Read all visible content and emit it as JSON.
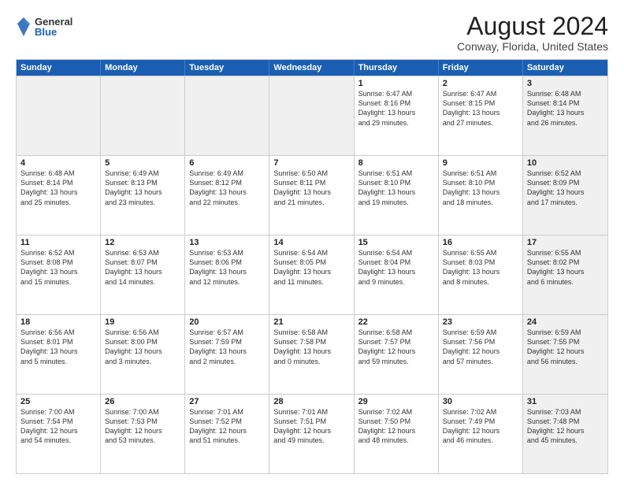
{
  "header": {
    "logo": {
      "general": "General",
      "blue": "Blue"
    },
    "title": "August 2024",
    "subtitle": "Conway, Florida, United States"
  },
  "weekdays": [
    "Sunday",
    "Monday",
    "Tuesday",
    "Wednesday",
    "Thursday",
    "Friday",
    "Saturday"
  ],
  "rows": [
    [
      {
        "day": "",
        "sunrise": "",
        "sunset": "",
        "daylight": "",
        "shaded": true
      },
      {
        "day": "",
        "sunrise": "",
        "sunset": "",
        "daylight": "",
        "shaded": true
      },
      {
        "day": "",
        "sunrise": "",
        "sunset": "",
        "daylight": "",
        "shaded": true
      },
      {
        "day": "",
        "sunrise": "",
        "sunset": "",
        "daylight": "",
        "shaded": true
      },
      {
        "day": "1",
        "sunrise": "Sunrise: 6:47 AM",
        "sunset": "Sunset: 8:16 PM",
        "daylight": "Daylight: 13 hours",
        "daylight2": "and 29 minutes.",
        "shaded": false
      },
      {
        "day": "2",
        "sunrise": "Sunrise: 6:47 AM",
        "sunset": "Sunset: 8:15 PM",
        "daylight": "Daylight: 13 hours",
        "daylight2": "and 27 minutes.",
        "shaded": false
      },
      {
        "day": "3",
        "sunrise": "Sunrise: 6:48 AM",
        "sunset": "Sunset: 8:14 PM",
        "daylight": "Daylight: 13 hours",
        "daylight2": "and 26 minutes.",
        "shaded": true
      }
    ],
    [
      {
        "day": "4",
        "sunrise": "Sunrise: 6:48 AM",
        "sunset": "Sunset: 8:14 PM",
        "daylight": "Daylight: 13 hours",
        "daylight2": "and 25 minutes.",
        "shaded": false
      },
      {
        "day": "5",
        "sunrise": "Sunrise: 6:49 AM",
        "sunset": "Sunset: 8:13 PM",
        "daylight": "Daylight: 13 hours",
        "daylight2": "and 23 minutes.",
        "shaded": false
      },
      {
        "day": "6",
        "sunrise": "Sunrise: 6:49 AM",
        "sunset": "Sunset: 8:12 PM",
        "daylight": "Daylight: 13 hours",
        "daylight2": "and 22 minutes.",
        "shaded": false
      },
      {
        "day": "7",
        "sunrise": "Sunrise: 6:50 AM",
        "sunset": "Sunset: 8:11 PM",
        "daylight": "Daylight: 13 hours",
        "daylight2": "and 21 minutes.",
        "shaded": false
      },
      {
        "day": "8",
        "sunrise": "Sunrise: 6:51 AM",
        "sunset": "Sunset: 8:10 PM",
        "daylight": "Daylight: 13 hours",
        "daylight2": "and 19 minutes.",
        "shaded": false
      },
      {
        "day": "9",
        "sunrise": "Sunrise: 6:51 AM",
        "sunset": "Sunset: 8:10 PM",
        "daylight": "Daylight: 13 hours",
        "daylight2": "and 18 minutes.",
        "shaded": false
      },
      {
        "day": "10",
        "sunrise": "Sunrise: 6:52 AM",
        "sunset": "Sunset: 8:09 PM",
        "daylight": "Daylight: 13 hours",
        "daylight2": "and 17 minutes.",
        "shaded": true
      }
    ],
    [
      {
        "day": "11",
        "sunrise": "Sunrise: 6:52 AM",
        "sunset": "Sunset: 8:08 PM",
        "daylight": "Daylight: 13 hours",
        "daylight2": "and 15 minutes.",
        "shaded": false
      },
      {
        "day": "12",
        "sunrise": "Sunrise: 6:53 AM",
        "sunset": "Sunset: 8:07 PM",
        "daylight": "Daylight: 13 hours",
        "daylight2": "and 14 minutes.",
        "shaded": false
      },
      {
        "day": "13",
        "sunrise": "Sunrise: 6:53 AM",
        "sunset": "Sunset: 8:06 PM",
        "daylight": "Daylight: 13 hours",
        "daylight2": "and 12 minutes.",
        "shaded": false
      },
      {
        "day": "14",
        "sunrise": "Sunrise: 6:54 AM",
        "sunset": "Sunset: 8:05 PM",
        "daylight": "Daylight: 13 hours",
        "daylight2": "and 11 minutes.",
        "shaded": false
      },
      {
        "day": "15",
        "sunrise": "Sunrise: 6:54 AM",
        "sunset": "Sunset: 8:04 PM",
        "daylight": "Daylight: 13 hours",
        "daylight2": "and 9 minutes.",
        "shaded": false
      },
      {
        "day": "16",
        "sunrise": "Sunrise: 6:55 AM",
        "sunset": "Sunset: 8:03 PM",
        "daylight": "Daylight: 13 hours",
        "daylight2": "and 8 minutes.",
        "shaded": false
      },
      {
        "day": "17",
        "sunrise": "Sunrise: 6:55 AM",
        "sunset": "Sunset: 8:02 PM",
        "daylight": "Daylight: 13 hours",
        "daylight2": "and 6 minutes.",
        "shaded": true
      }
    ],
    [
      {
        "day": "18",
        "sunrise": "Sunrise: 6:56 AM",
        "sunset": "Sunset: 8:01 PM",
        "daylight": "Daylight: 13 hours",
        "daylight2": "and 5 minutes.",
        "shaded": false
      },
      {
        "day": "19",
        "sunrise": "Sunrise: 6:56 AM",
        "sunset": "Sunset: 8:00 PM",
        "daylight": "Daylight: 13 hours",
        "daylight2": "and 3 minutes.",
        "shaded": false
      },
      {
        "day": "20",
        "sunrise": "Sunrise: 6:57 AM",
        "sunset": "Sunset: 7:59 PM",
        "daylight": "Daylight: 13 hours",
        "daylight2": "and 2 minutes.",
        "shaded": false
      },
      {
        "day": "21",
        "sunrise": "Sunrise: 6:58 AM",
        "sunset": "Sunset: 7:58 PM",
        "daylight": "Daylight: 13 hours",
        "daylight2": "and 0 minutes.",
        "shaded": false
      },
      {
        "day": "22",
        "sunrise": "Sunrise: 6:58 AM",
        "sunset": "Sunset: 7:57 PM",
        "daylight": "Daylight: 12 hours",
        "daylight2": "and 59 minutes.",
        "shaded": false
      },
      {
        "day": "23",
        "sunrise": "Sunrise: 6:59 AM",
        "sunset": "Sunset: 7:56 PM",
        "daylight": "Daylight: 12 hours",
        "daylight2": "and 57 minutes.",
        "shaded": false
      },
      {
        "day": "24",
        "sunrise": "Sunrise: 6:59 AM",
        "sunset": "Sunset: 7:55 PM",
        "daylight": "Daylight: 12 hours",
        "daylight2": "and 56 minutes.",
        "shaded": true
      }
    ],
    [
      {
        "day": "25",
        "sunrise": "Sunrise: 7:00 AM",
        "sunset": "Sunset: 7:54 PM",
        "daylight": "Daylight: 12 hours",
        "daylight2": "and 54 minutes.",
        "shaded": false
      },
      {
        "day": "26",
        "sunrise": "Sunrise: 7:00 AM",
        "sunset": "Sunset: 7:53 PM",
        "daylight": "Daylight: 12 hours",
        "daylight2": "and 53 minutes.",
        "shaded": false
      },
      {
        "day": "27",
        "sunrise": "Sunrise: 7:01 AM",
        "sunset": "Sunset: 7:52 PM",
        "daylight": "Daylight: 12 hours",
        "daylight2": "and 51 minutes.",
        "shaded": false
      },
      {
        "day": "28",
        "sunrise": "Sunrise: 7:01 AM",
        "sunset": "Sunset: 7:51 PM",
        "daylight": "Daylight: 12 hours",
        "daylight2": "and 49 minutes.",
        "shaded": false
      },
      {
        "day": "29",
        "sunrise": "Sunrise: 7:02 AM",
        "sunset": "Sunset: 7:50 PM",
        "daylight": "Daylight: 12 hours",
        "daylight2": "and 48 minutes.",
        "shaded": false
      },
      {
        "day": "30",
        "sunrise": "Sunrise: 7:02 AM",
        "sunset": "Sunset: 7:49 PM",
        "daylight": "Daylight: 12 hours",
        "daylight2": "and 46 minutes.",
        "shaded": false
      },
      {
        "day": "31",
        "sunrise": "Sunrise: 7:03 AM",
        "sunset": "Sunset: 7:48 PM",
        "daylight": "Daylight: 12 hours",
        "daylight2": "and 45 minutes.",
        "shaded": true
      }
    ]
  ]
}
